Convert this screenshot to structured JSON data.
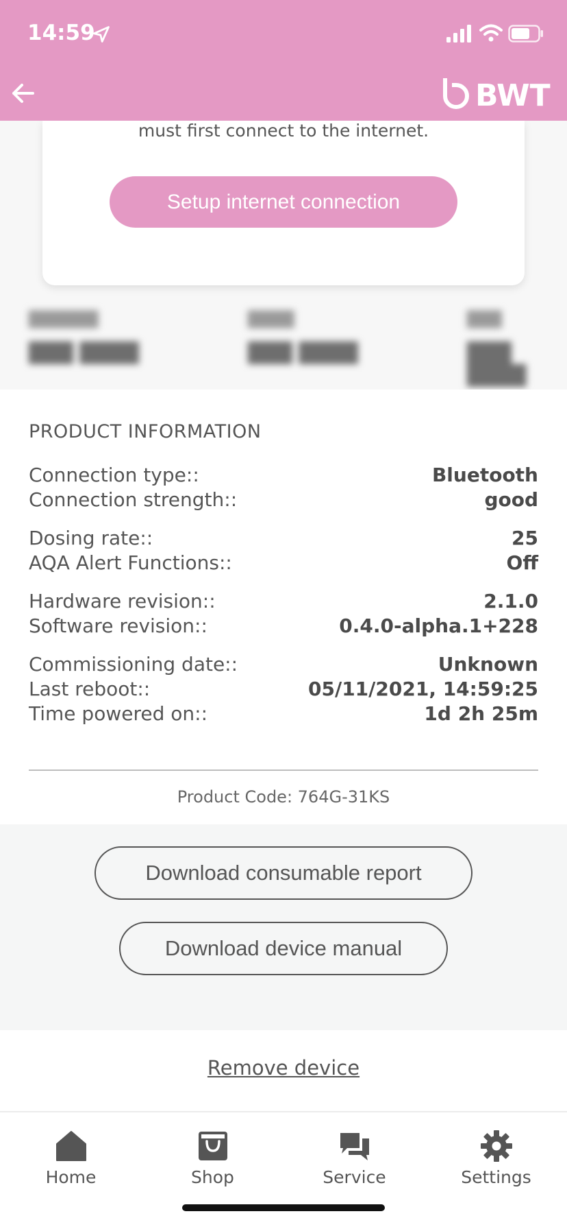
{
  "status_bar": {
    "time": "14:59"
  },
  "header": {
    "brand": "BWT"
  },
  "card": {
    "text": "must first connect to the internet.",
    "button_label": "Setup internet connection"
  },
  "product_info": {
    "title": "PRODUCT INFORMATION",
    "rows": [
      {
        "label": "Connection type::",
        "value": "Bluetooth"
      },
      {
        "label": "Connection strength::",
        "value": "good"
      },
      {
        "label": "Dosing rate::",
        "value": "25"
      },
      {
        "label": "AQA Alert Functions::",
        "value": "Off"
      },
      {
        "label": "Hardware revision::",
        "value": "2.1.0"
      },
      {
        "label": "Software revision::",
        "value": "0.4.0-alpha.1+228"
      },
      {
        "label": "Commissioning date::",
        "value": "Unknown"
      },
      {
        "label": "Last reboot::",
        "value": "05/11/2021, 14:59:25"
      },
      {
        "label": "Time powered on::",
        "value": "1d 2h 25m"
      }
    ],
    "product_code": "Product Code: 764G-31KS"
  },
  "actions": {
    "download_report": "Download consumable report",
    "download_manual": "Download device manual",
    "remove_device": "Remove device"
  },
  "tabbar": {
    "items": [
      {
        "label": "Home",
        "icon": "home-icon"
      },
      {
        "label": "Shop",
        "icon": "shopping-bag-icon"
      },
      {
        "label": "Service",
        "icon": "chat-icon"
      },
      {
        "label": "Settings",
        "icon": "gear-icon"
      }
    ]
  },
  "colors": {
    "brand_pink": "#e499c4",
    "text": "#4a4a4a"
  }
}
